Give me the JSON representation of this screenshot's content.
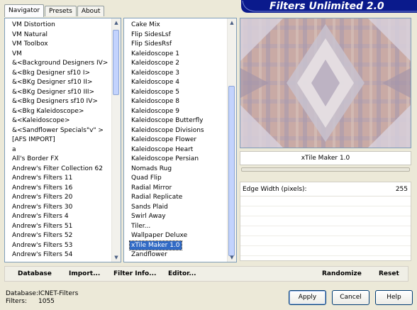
{
  "tabs": [
    "Navigator",
    "Presets",
    "About"
  ],
  "banner_title": "Filters Unlimited 2.0",
  "categories": [
    "VM Distortion",
    "VM Natural",
    "VM Toolbox",
    "VM",
    "&<Background Designers IV>",
    "&<Bkg Designer sf10 I>",
    "&<BKg Designer sf10 II>",
    "&<BKg Designer sf10 III>",
    "&<Bkg Designers sf10 IV>",
    "&<Bkg Kaleidoscope>",
    "&<Kaleidoscope>",
    "&<Sandflower Specials\"v\" >",
    "[AFS IMPORT]",
    "a",
    "All's Border FX",
    "Andrew's Filter Collection 62",
    "Andrew's Filters 11",
    "Andrew's Filters 16",
    "Andrew's Filters 20",
    "Andrew's Filters 30",
    "Andrew's Filters 4",
    "Andrew's Filters 51",
    "Andrew's Filters 52",
    "Andrew's Filters 53",
    "Andrew's Filters 54"
  ],
  "filters": [
    "Cake Mix",
    "Flip SidesLsf",
    "Flip SidesRsf",
    "Kaleidoscope 1",
    "Kaleidoscope 2",
    "Kaleidoscope 3",
    "Kaleidoscope 4",
    "Kaleidoscope 5",
    "Kaleidoscope 8",
    "Kaleidoscope 9",
    "Kaleidoscope Butterfly",
    "Kaleidoscope Divisions",
    "Kaleidoscope Flower",
    "Kaleidoscope Heart",
    "Kaleidoscope Persian",
    "Nomads Rug",
    "Quad Flip",
    "Radial Mirror",
    "Radial Replicate",
    "Sands Plaid",
    "Swirl Away",
    "Tiler...",
    "Wallpaper Deluxe",
    "xTile Maker 1.0",
    "Zandflower"
  ],
  "selected_filter": "xTile Maker 1.0",
  "preview_filter_name": "xTile Maker 1.0",
  "param": {
    "label": "Edge Width (pixels):",
    "value": "255"
  },
  "bottom": {
    "database": "Database",
    "import": "Import...",
    "filter_info": "Filter Info...",
    "editor": "Editor...",
    "randomize": "Randomize",
    "reset": "Reset"
  },
  "status": {
    "database_label": "Database:",
    "database_value": "ICNET-Filters",
    "filters_label": "Filters:",
    "filters_value": "1055"
  },
  "buttons": {
    "apply": "Apply",
    "cancel": "Cancel",
    "help": "Help"
  },
  "colors": {
    "banner": "#0a1a8c",
    "selection": "#316ac5"
  }
}
